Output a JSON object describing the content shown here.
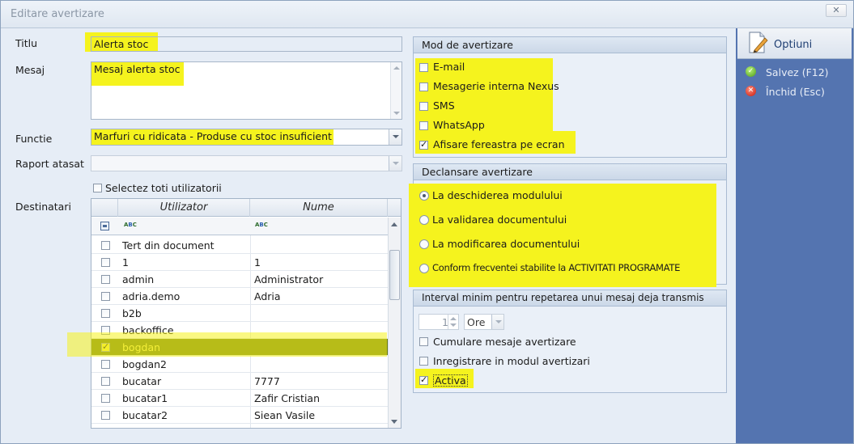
{
  "window": {
    "title": "Editare avertizare",
    "close_glyph": "✕"
  },
  "form": {
    "titlu_label": "Titlu",
    "titlu_value": "Alerta stoc",
    "mesaj_label": "Mesaj",
    "mesaj_value": "Mesaj alerta stoc",
    "functie_label": "Functie",
    "functie_value": "Marfuri cu ridicata - Produse cu stoc insuficient",
    "raport_label": "Raport atasat",
    "raport_value": "",
    "select_all_label": "Selectez toti utilizatorii",
    "destinatari_label": "Destinatari"
  },
  "grid": {
    "columns": [
      "Utilizator",
      "Nume"
    ],
    "filter_icon": "abc-filter-icon",
    "rows": [
      {
        "user": "Tert din document",
        "name": "",
        "checked": false
      },
      {
        "user": "1",
        "name": "1",
        "checked": false
      },
      {
        "user": "admin",
        "name": "Administrator",
        "checked": false
      },
      {
        "user": "adria.demo",
        "name": "Adria",
        "checked": false
      },
      {
        "user": "b2b",
        "name": "",
        "checked": false
      },
      {
        "user": "backoffice",
        "name": "",
        "checked": false
      },
      {
        "user": "bogdan",
        "name": "",
        "checked": true,
        "selected": true
      },
      {
        "user": "bogdan2",
        "name": "",
        "checked": false
      },
      {
        "user": "bucatar",
        "name": "7777",
        "checked": false
      },
      {
        "user": "bucatar1",
        "name": "Zafir Cristian",
        "checked": false
      },
      {
        "user": "bucatar2",
        "name": "Siean Vasile",
        "checked": false
      }
    ]
  },
  "mod": {
    "title": "Mod de avertizare",
    "options": [
      {
        "label": "E-mail",
        "checked": false
      },
      {
        "label": "Mesagerie interna Nexus",
        "checked": false
      },
      {
        "label": "SMS",
        "checked": false
      },
      {
        "label": "WhatsApp",
        "checked": false
      },
      {
        "label": "Afisare fereastra pe ecran",
        "checked": true
      }
    ]
  },
  "declansare": {
    "title": "Declansare avertizare",
    "options": [
      {
        "label": "La deschiderea modulului",
        "selected": true
      },
      {
        "label": "La validarea documentului",
        "selected": false
      },
      {
        "label": "La modificarea documentului",
        "selected": false
      },
      {
        "label": "Conform frecventei stabilite la ACTIVITATI PROGRAMATE",
        "selected": false
      }
    ]
  },
  "interval": {
    "title": "Interval minim pentru repetarea unui mesaj deja transmis",
    "value": "1",
    "unit": "Ore",
    "cumulare_label": "Cumulare mesaje avertizare",
    "cumulare_checked": false,
    "inregistrare_label": "Inregistrare in modul avertizari",
    "inregistrare_checked": false,
    "activa_label": "Activa",
    "activa_checked": true
  },
  "sidebar": {
    "title": "Optiuni",
    "save_label": "Salvez (F12)",
    "close_label": "Închid (Esc)"
  },
  "colors": {
    "highlight": "#f5f31e",
    "sidebar": "#5474b0",
    "selected_row": "#6a7b12"
  }
}
